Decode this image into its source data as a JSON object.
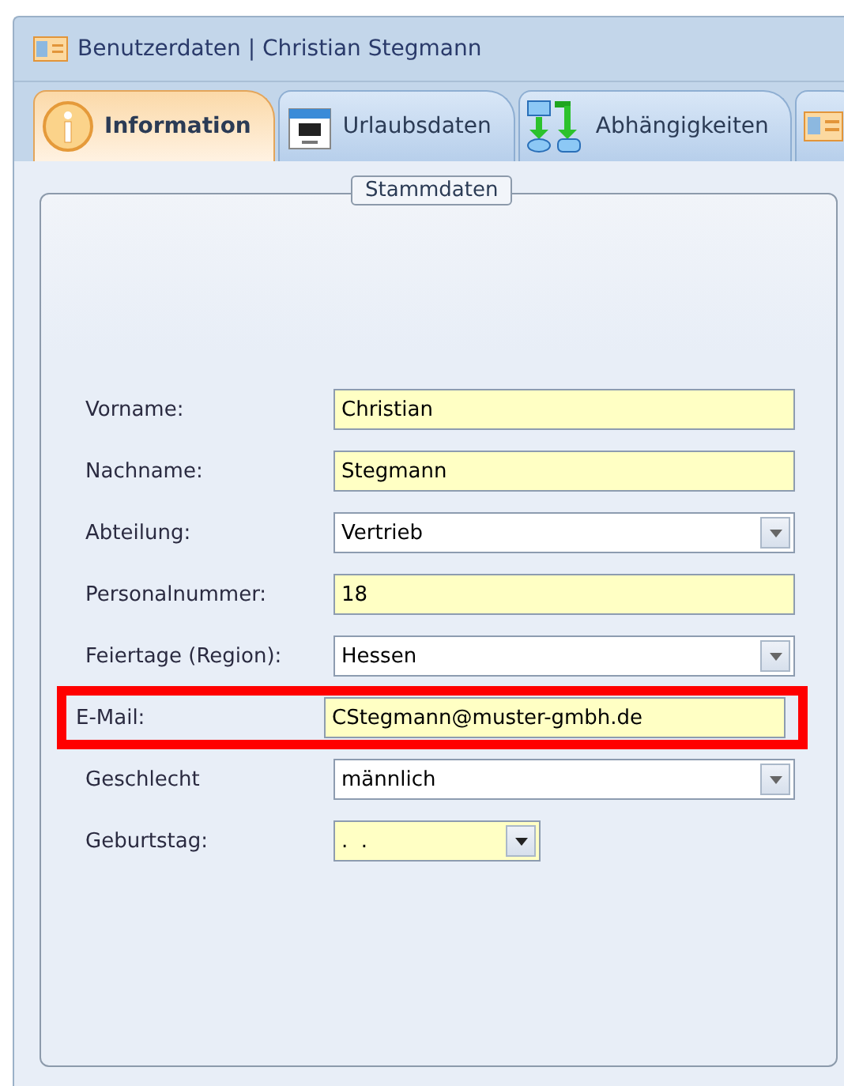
{
  "window": {
    "title": "Benutzerdaten | Christian Stegmann"
  },
  "tabs": [
    {
      "kind": "info",
      "label": "Information",
      "selected": true
    },
    {
      "kind": "calendar",
      "label": "Urlaubsdaten",
      "selected": false
    },
    {
      "kind": "flow",
      "label": "Abhängigkeiten",
      "selected": false
    },
    {
      "kind": "card",
      "selected": false
    }
  ],
  "group": {
    "title": "Stammdaten"
  },
  "fields": [
    {
      "kind": "text",
      "label": "Vorname:",
      "value": "Christian",
      "highlighted": false
    },
    {
      "kind": "text",
      "label": "Nachname:",
      "value": "Stegmann",
      "highlighted": false
    },
    {
      "kind": "combo",
      "label": "Abteilung:",
      "value": "Vertrieb",
      "highlighted": false
    },
    {
      "kind": "text",
      "label": "Personalnummer:",
      "value": "18",
      "highlighted": false
    },
    {
      "kind": "combo",
      "label": "Feiertage (Region):",
      "value": "Hessen",
      "highlighted": false
    },
    {
      "kind": "text",
      "label": "E-Mail:",
      "value": "CStegmann@muster-gmbh.de",
      "highlighted": true
    },
    {
      "kind": "combo",
      "label": "Geschlecht",
      "value": "männlich",
      "highlighted": false
    },
    {
      "kind": "date",
      "label": "Geburtstag:",
      "value": ".  .",
      "highlighted": false
    }
  ]
}
